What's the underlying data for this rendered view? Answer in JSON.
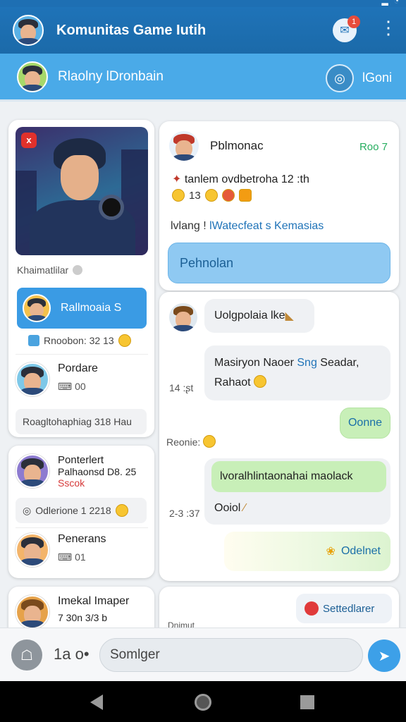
{
  "app": {
    "title": "Komunitas Game Iutih",
    "notification_count": "1"
  },
  "subheader": {
    "title": "Rlaolny lDronbain",
    "action_label": "lGoni"
  },
  "left_cards": {
    "hero_caption": "Khaimatlilar",
    "active_item_label": "Rallmoaia S",
    "active_item_stat": "Rnoobon: 32  13",
    "item2": {
      "name": "Pordare",
      "meta": "00"
    },
    "card1_footer": "Roagltohaphiag  318 Hau",
    "card2": {
      "name": "Ponterlert",
      "sub": "Palhaonsd D8. 25",
      "tag": "Sscok",
      "bar": "Odlerione  1 2218"
    },
    "item3": {
      "name": "Penerans",
      "meta": "01"
    },
    "card3": {
      "name": "Imekal Imaper",
      "meta": "7 30n  3/3 b"
    }
  },
  "post": {
    "author": "Pblmonac",
    "badge": "Roo 7",
    "line1": "tanlem ovdbetroha 12 :th",
    "line2_count": "13",
    "line3_prefix": "lvlang ! ",
    "line3_link": "lWatecfeat s Kemasias",
    "cta": "Pehnolan"
  },
  "chat": {
    "msg1": "Uolgpolaia lke",
    "msg2_line1": "Masiryon Naoer ",
    "msg2_hl": "Sng",
    "msg2_line1_end": " Seadar,",
    "msg2_line2": "Rahaot",
    "ts1": "14 :ʂt",
    "reply1": "Oonne",
    "ts2": "Reonie:",
    "msg3": "lvoralhlintaonahai maolack",
    "msg3_sub": "Ooiol",
    "ts3": "2-3 :37",
    "reply2": "Odelnet",
    "ts4": "Dnimut"
  },
  "pill": {
    "label": "Settedlarer"
  },
  "composer": {
    "count": "1a o•",
    "placeholder": "Somlger"
  },
  "colors": {
    "appbar": "#1f73b8",
    "subbar": "#4aaae8",
    "accent": "#3a9be4",
    "success": "#27ae60"
  }
}
